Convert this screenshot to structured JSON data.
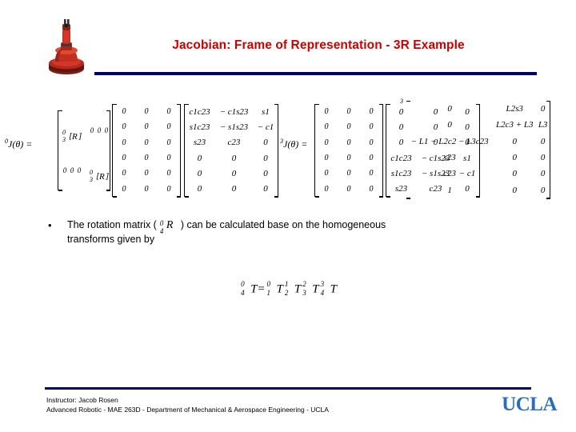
{
  "slide": {
    "title": "Jacobian: Frame of Representation - 3R Example",
    "title_color": "#cc0000",
    "rule_color": "#000066"
  },
  "equations": {
    "lhs1_pre_sup": "0",
    "lhs1_main": "J",
    "lhs1_arg": "(θ) =",
    "lhs2_pre_sup": "3",
    "lhs2_main": "J",
    "lhs2_arg": "(θ) =",
    "block1": {
      "rows": [
        [
          "[ R ]",
          "0 0 0"
        ],
        [
          "0 0 0",
          "[ R ]"
        ]
      ],
      "r_label": "R",
      "r_sup": "0",
      "r_sub": "3"
    },
    "matrix_zeros_1": [
      [
        "0",
        "0",
        "0"
      ],
      [
        "0",
        "0",
        "0"
      ],
      [
        "0",
        "0",
        "0"
      ],
      [
        "0",
        "0",
        "0"
      ],
      [
        "0",
        "0",
        "0"
      ],
      [
        "0",
        "0",
        "0"
      ]
    ],
    "matrix_rot": [
      [
        "c1c23",
        "− c1s23",
        "s1"
      ],
      [
        "s1c23",
        "− s1s23",
        "− c1"
      ],
      [
        "s23",
        "c23",
        "0"
      ],
      [
        "0",
        "0",
        "0"
      ],
      [
        "0",
        "0",
        "0"
      ],
      [
        "0",
        "0",
        "0"
      ]
    ],
    "matrix_zeros_2": [
      [
        "0",
        "0",
        "0"
      ],
      [
        "0",
        "0",
        "0"
      ],
      [
        "0",
        "0",
        "0"
      ],
      [
        "c1c23",
        "− c1s23",
        "s1"
      ],
      [
        "s1c23",
        "− s1s23",
        "− c1"
      ],
      [
        "s23",
        "c23",
        "0"
      ]
    ],
    "matrix_jacobian": [
      [
        "0",
        "L2s3",
        "0"
      ],
      [
        "0",
        "L2c3 + L3",
        "L3"
      ],
      [
        "− L1 − L2c2 − L3c23",
        "0",
        "0"
      ],
      [
        "s23",
        "0",
        "0"
      ],
      [
        "c23",
        "0",
        "0"
      ],
      [
        "1",
        "0",
        "0"
      ]
    ],
    "matrix_jacobian_pre_sup": "3"
  },
  "bullet": {
    "dot": "•",
    "text_before": "The rotation matrix (",
    "r_sup": "0",
    "r_main": "R",
    "r_sub": "4",
    "text_after": ")  can be calculated base on the homogeneous",
    "text_line2": "transforms given by"
  },
  "center_equation": {
    "lhs_sup": "0",
    "lhs_sub": "4",
    "lhs_main": "T",
    "equals": "=",
    "t1_sup": "0",
    "t1_sub": "1",
    "t1_main": "T",
    "t2_sup": "1",
    "t2_sub": "2",
    "t2_main": "T",
    "t3_sup": "2",
    "t3_sub": "3",
    "t3_main": "T",
    "t4_sup": "3",
    "t4_sub": "4",
    "t4_main": "T"
  },
  "footer": {
    "line1": "Instructor: Jacob Rosen",
    "line2": "Advanced Robotic - MAE 263D - Department of Mechanical & Aerospace Engineering - UCLA",
    "logo": "UCLA",
    "logo_color": "#2a6ebb"
  }
}
